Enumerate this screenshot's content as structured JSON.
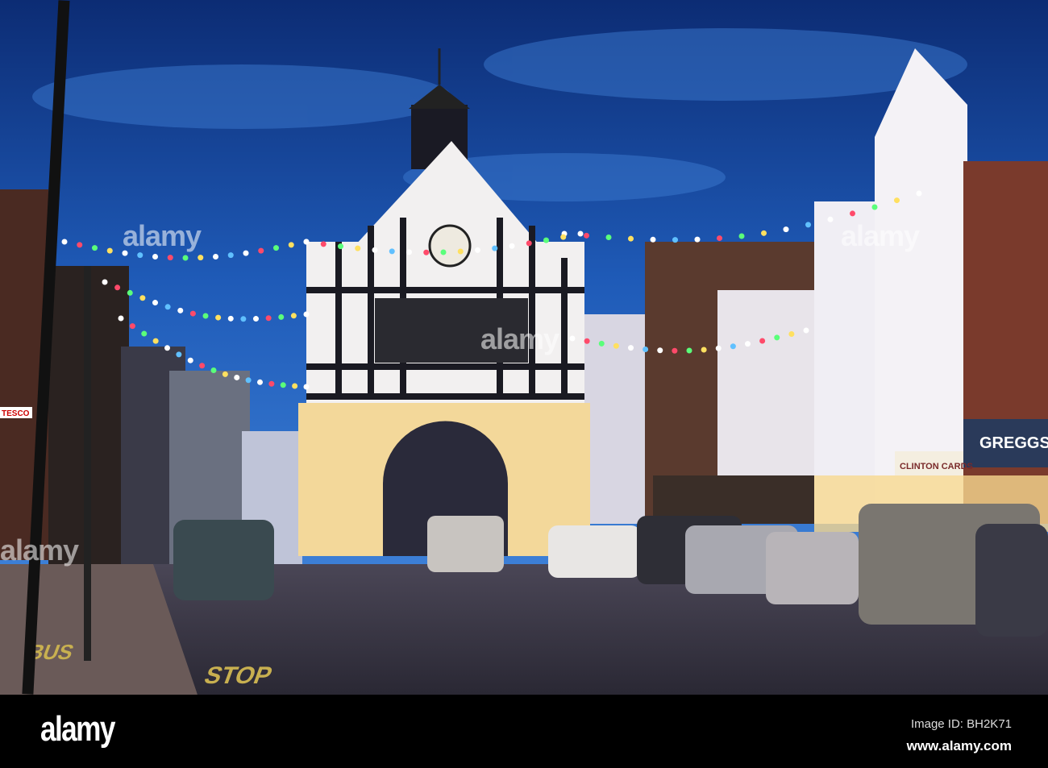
{
  "photo": {
    "description_tags": [
      "town-hall",
      "street",
      "festoon-lights",
      "dusk"
    ],
    "signs": {
      "shop_greggs": "GREGGS",
      "shop_clinton": "CLINTON CARDS",
      "shop_tesco": "TESCO",
      "road_marking_bus": "BUS",
      "road_marking_stop": "STOP"
    },
    "colors": {
      "sky_top": "#0d2f7a",
      "sky_bottom": "#2a6fd0",
      "road": "#3b3a4a",
      "light_warm": "#ffe9a0"
    }
  },
  "watermark": {
    "text": "alamy"
  },
  "footer": {
    "logo": "alamy",
    "image_id": "Image ID: BH2K71",
    "url": "www.alamy.com"
  }
}
